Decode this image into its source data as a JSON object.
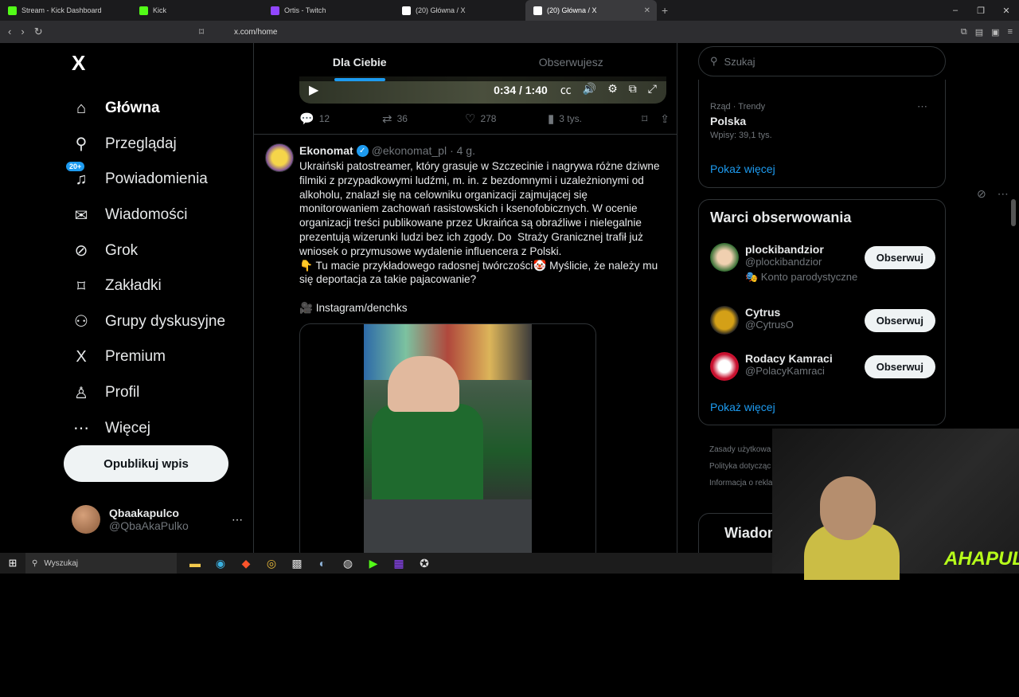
{
  "browser": {
    "tabs": [
      {
        "label": "Stream - Kick Dashboard",
        "color": "#53fc18"
      },
      {
        "label": "Kick",
        "color": "#53fc18"
      },
      {
        "label": "Ortis - Twitch",
        "color": "#9146ff"
      },
      {
        "label": "(20) Główna / X",
        "color": "#ffffff"
      },
      {
        "label": "(20) Główna / X",
        "color": "#ffffff"
      }
    ],
    "new_tab": "+",
    "url": "x.com/home"
  },
  "sidebar": {
    "logo": "X",
    "items": [
      {
        "label": "Główna",
        "icon": "home-icon",
        "glyph": "⌂"
      },
      {
        "label": "Przeglądaj",
        "icon": "search-icon",
        "glyph": "⚲"
      },
      {
        "label": "Powiadomienia",
        "icon": "bell-icon",
        "glyph": "🔔"
      },
      {
        "label": "Wiadomości",
        "icon": "mail-icon",
        "glyph": "✉"
      },
      {
        "label": "Grok",
        "icon": "grok-icon",
        "glyph": "⊘"
      },
      {
        "label": "Zakładki",
        "icon": "bookmark-icon",
        "glyph": "⌑"
      },
      {
        "label": "Grupy dyskusyjne",
        "icon": "communities-icon",
        "glyph": "⚇"
      },
      {
        "label": "Premium",
        "icon": "x-premium-icon",
        "glyph": "X"
      },
      {
        "label": "Profil",
        "icon": "profile-icon",
        "glyph": "♙"
      },
      {
        "label": "Więcej",
        "icon": "more-circle-icon",
        "glyph": "⋯"
      }
    ],
    "notif_badge": "20+",
    "post_button": "Opublikuj wpis",
    "profile": {
      "name": "Qbaakapulco",
      "handle": "@QbaAkaPulko",
      "more": "⋯"
    }
  },
  "feed": {
    "tabs": [
      {
        "label": "Dla Ciebie"
      },
      {
        "label": "Obserwujesz"
      }
    ],
    "video": {
      "time": "0:34 / 1:40"
    },
    "prev_actions": {
      "replies": "12",
      "reposts": "36",
      "likes": "278",
      "views": "3 tys."
    },
    "tweet": {
      "name": "Ekonomat",
      "handle": "@ekonomat_pl",
      "time": "· 4 g.",
      "text": "Ukraiński patostreamer, który grasuje w Szczecinie i nagrywa różne dziwne filmiki z przypadkowymi ludźmi, m. in. z bezdomnymi i uzależnionymi od alkoholu, znalazł się na celowniku organizacji zajmującej się monitorowaniem zachowań rasistowskich i ksenofobicznych. W ocenie organizacji treści publikowane przez Ukraińca są obraźliwe i nielegalnie prezentują wizerunki ludzi bez ich zgody. Do  Straży Granicznej trafił już wniosek o przymusowe wydalenie influencera z Polski.\n👇 Tu macie przykładowego radosnej twórczości🤡 Myślicie, że należy mu się deportacja za takie pajacowanie?\n\n🎥 Instagram/denchks"
    }
  },
  "right": {
    "search_placeholder": "Szukaj",
    "trend": {
      "meta": "Rząd · Trendy",
      "name": "Polska",
      "count": "Wpisy: 39,1 tys."
    },
    "show_more": "Pokaż więcej",
    "who_to_follow": {
      "title": "Warci obserwowania",
      "accounts": [
        {
          "name": "plockibandzior",
          "handle": "@plockibandzior",
          "note": "🎭 Konto parodystyczne",
          "color": "#2f6b2f"
        },
        {
          "name": "Cytrus",
          "handle": "@CytrusO",
          "note": "",
          "color": "#d4a017"
        },
        {
          "name": "Rodacy Kamraci",
          "handle": "@PolacyKamraci",
          "note": "",
          "color": "#c8102e"
        }
      ],
      "follow_label": "Obserwuj",
      "show_more": "Pokaż więcej"
    },
    "footer": [
      "Zasady użytkowa",
      "Polityka dotycząc",
      "Informacja o rekla"
    ],
    "messages": "Wiadom"
  },
  "overlay": {
    "watermark": "AHAPULCO"
  },
  "taskbar": {
    "search": "Wyszukaj"
  }
}
